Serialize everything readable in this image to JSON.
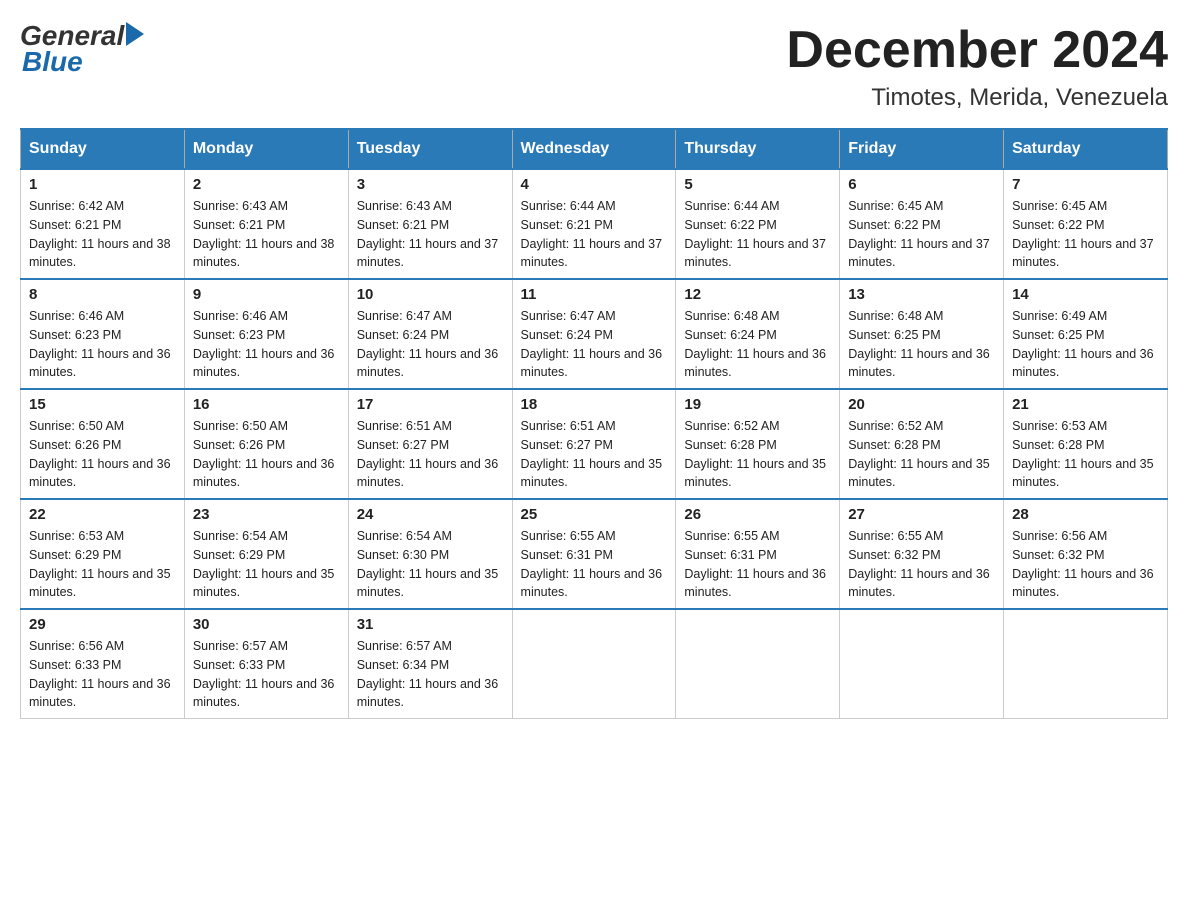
{
  "logo": {
    "general": "General",
    "blue": "Blue"
  },
  "title": {
    "month_year": "December 2024",
    "location": "Timotes, Merida, Venezuela"
  },
  "headers": [
    "Sunday",
    "Monday",
    "Tuesday",
    "Wednesday",
    "Thursday",
    "Friday",
    "Saturday"
  ],
  "weeks": [
    [
      {
        "day": "1",
        "sunrise": "6:42 AM",
        "sunset": "6:21 PM",
        "daylight": "11 hours and 38 minutes."
      },
      {
        "day": "2",
        "sunrise": "6:43 AM",
        "sunset": "6:21 PM",
        "daylight": "11 hours and 38 minutes."
      },
      {
        "day": "3",
        "sunrise": "6:43 AM",
        "sunset": "6:21 PM",
        "daylight": "11 hours and 37 minutes."
      },
      {
        "day": "4",
        "sunrise": "6:44 AM",
        "sunset": "6:21 PM",
        "daylight": "11 hours and 37 minutes."
      },
      {
        "day": "5",
        "sunrise": "6:44 AM",
        "sunset": "6:22 PM",
        "daylight": "11 hours and 37 minutes."
      },
      {
        "day": "6",
        "sunrise": "6:45 AM",
        "sunset": "6:22 PM",
        "daylight": "11 hours and 37 minutes."
      },
      {
        "day": "7",
        "sunrise": "6:45 AM",
        "sunset": "6:22 PM",
        "daylight": "11 hours and 37 minutes."
      }
    ],
    [
      {
        "day": "8",
        "sunrise": "6:46 AM",
        "sunset": "6:23 PM",
        "daylight": "11 hours and 36 minutes."
      },
      {
        "day": "9",
        "sunrise": "6:46 AM",
        "sunset": "6:23 PM",
        "daylight": "11 hours and 36 minutes."
      },
      {
        "day": "10",
        "sunrise": "6:47 AM",
        "sunset": "6:24 PM",
        "daylight": "11 hours and 36 minutes."
      },
      {
        "day": "11",
        "sunrise": "6:47 AM",
        "sunset": "6:24 PM",
        "daylight": "11 hours and 36 minutes."
      },
      {
        "day": "12",
        "sunrise": "6:48 AM",
        "sunset": "6:24 PM",
        "daylight": "11 hours and 36 minutes."
      },
      {
        "day": "13",
        "sunrise": "6:48 AM",
        "sunset": "6:25 PM",
        "daylight": "11 hours and 36 minutes."
      },
      {
        "day": "14",
        "sunrise": "6:49 AM",
        "sunset": "6:25 PM",
        "daylight": "11 hours and 36 minutes."
      }
    ],
    [
      {
        "day": "15",
        "sunrise": "6:50 AM",
        "sunset": "6:26 PM",
        "daylight": "11 hours and 36 minutes."
      },
      {
        "day": "16",
        "sunrise": "6:50 AM",
        "sunset": "6:26 PM",
        "daylight": "11 hours and 36 minutes."
      },
      {
        "day": "17",
        "sunrise": "6:51 AM",
        "sunset": "6:27 PM",
        "daylight": "11 hours and 36 minutes."
      },
      {
        "day": "18",
        "sunrise": "6:51 AM",
        "sunset": "6:27 PM",
        "daylight": "11 hours and 35 minutes."
      },
      {
        "day": "19",
        "sunrise": "6:52 AM",
        "sunset": "6:28 PM",
        "daylight": "11 hours and 35 minutes."
      },
      {
        "day": "20",
        "sunrise": "6:52 AM",
        "sunset": "6:28 PM",
        "daylight": "11 hours and 35 minutes."
      },
      {
        "day": "21",
        "sunrise": "6:53 AM",
        "sunset": "6:28 PM",
        "daylight": "11 hours and 35 minutes."
      }
    ],
    [
      {
        "day": "22",
        "sunrise": "6:53 AM",
        "sunset": "6:29 PM",
        "daylight": "11 hours and 35 minutes."
      },
      {
        "day": "23",
        "sunrise": "6:54 AM",
        "sunset": "6:29 PM",
        "daylight": "11 hours and 35 minutes."
      },
      {
        "day": "24",
        "sunrise": "6:54 AM",
        "sunset": "6:30 PM",
        "daylight": "11 hours and 35 minutes."
      },
      {
        "day": "25",
        "sunrise": "6:55 AM",
        "sunset": "6:31 PM",
        "daylight": "11 hours and 36 minutes."
      },
      {
        "day": "26",
        "sunrise": "6:55 AM",
        "sunset": "6:31 PM",
        "daylight": "11 hours and 36 minutes."
      },
      {
        "day": "27",
        "sunrise": "6:55 AM",
        "sunset": "6:32 PM",
        "daylight": "11 hours and 36 minutes."
      },
      {
        "day": "28",
        "sunrise": "6:56 AM",
        "sunset": "6:32 PM",
        "daylight": "11 hours and 36 minutes."
      }
    ],
    [
      {
        "day": "29",
        "sunrise": "6:56 AM",
        "sunset": "6:33 PM",
        "daylight": "11 hours and 36 minutes."
      },
      {
        "day": "30",
        "sunrise": "6:57 AM",
        "sunset": "6:33 PM",
        "daylight": "11 hours and 36 minutes."
      },
      {
        "day": "31",
        "sunrise": "6:57 AM",
        "sunset": "6:34 PM",
        "daylight": "11 hours and 36 minutes."
      },
      null,
      null,
      null,
      null
    ]
  ]
}
